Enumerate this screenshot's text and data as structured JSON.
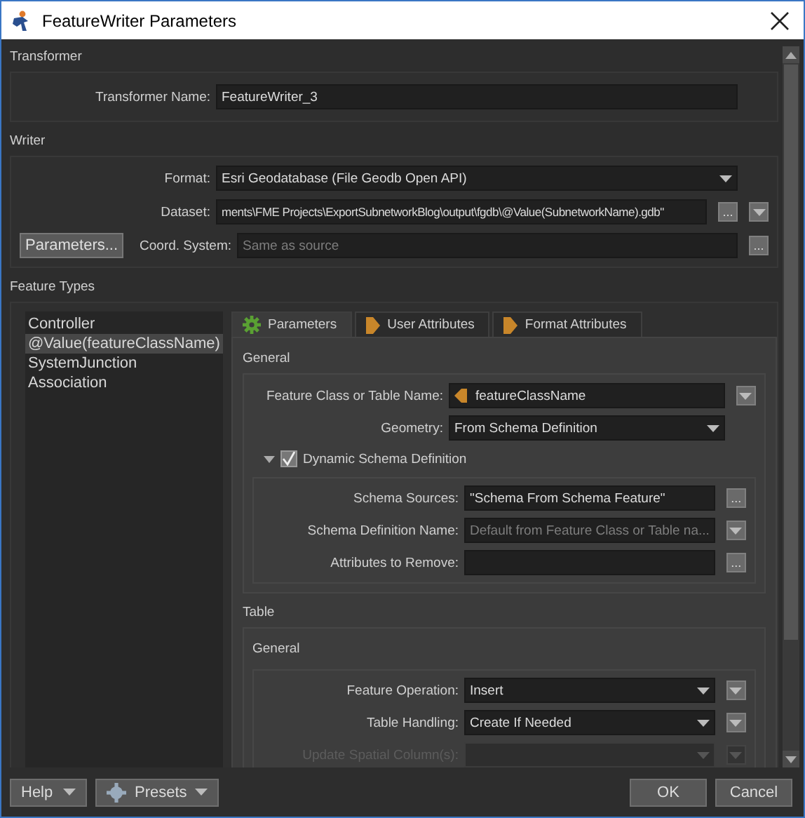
{
  "window": {
    "title": "FeatureWriter Parameters"
  },
  "transformer": {
    "heading": "Transformer",
    "fields": [
      {
        "label": "Transformer Name:",
        "kind": "text",
        "value": "FeatureWriter_3"
      }
    ]
  },
  "writer": {
    "heading": "Writer",
    "fields": [
      {
        "label": "Format:",
        "kind": "combo",
        "value": "Esri Geodatabase (File Geodb Open API)"
      },
      {
        "label": "Dataset:",
        "kind": "text",
        "value": "ments\\FME Projects\\ExportSubnetworkBlog\\output\\fgdb\\@Value(SubnetworkName).gdb\"",
        "buttons": [
          {
            "kind": "ellipsis",
            "text": "..."
          },
          {
            "kind": "menu"
          }
        ]
      },
      {
        "label": "Coord. System:",
        "kind": "text",
        "placeholder": "Same as source",
        "buttons": [
          {
            "kind": "ellipsis",
            "text": "..."
          }
        ]
      }
    ],
    "parameters_button": "Parameters..."
  },
  "feature_types": {
    "heading": "Feature Types",
    "items": [
      {
        "label": "Controller",
        "selected": false
      },
      {
        "label": "@Value(featureClassName)",
        "selected": true
      },
      {
        "label": "SystemJunction",
        "selected": false
      },
      {
        "label": "Association",
        "selected": false
      }
    ]
  },
  "tabs": [
    {
      "label": "Parameters",
      "kind": "gear",
      "selected": true
    },
    {
      "label": "User Attributes",
      "kind": "arrow",
      "selected": false
    },
    {
      "label": "Format Attributes",
      "kind": "arrow",
      "selected": false
    }
  ],
  "general": {
    "heading": "General",
    "fields": [
      {
        "label": "Feature Class or Table Name:",
        "kind": "attribute",
        "value": "featureClassName",
        "buttons": [
          {
            "kind": "menu"
          }
        ]
      },
      {
        "label": "Geometry:",
        "kind": "combo",
        "value": "From Schema Definition"
      }
    ],
    "dynamic_schema": {
      "label": "Dynamic Schema Definition",
      "checked": true,
      "expanded": true,
      "fields": [
        {
          "label": "Schema Sources:",
          "kind": "text",
          "value": "\"Schema From Schema Feature\"",
          "buttons": [
            {
              "kind": "ellipsis",
              "text": "..."
            }
          ]
        },
        {
          "label": "Schema Definition Name:",
          "kind": "text",
          "placeholder": "Default from Feature Class or Table na...",
          "buttons": [
            {
              "kind": "menu"
            }
          ]
        },
        {
          "label": "Attributes to Remove:",
          "kind": "text",
          "buttons": [
            {
              "kind": "ellipsis",
              "text": "..."
            }
          ]
        }
      ]
    }
  },
  "table": {
    "heading": "Table",
    "subheading": "General",
    "fields": [
      {
        "label": "Feature Operation:",
        "kind": "combo",
        "value": "Insert",
        "buttons": [
          {
            "kind": "menu"
          }
        ],
        "disabled": false
      },
      {
        "label": "Table Handling:",
        "kind": "combo",
        "value": "Create If Needed",
        "buttons": [
          {
            "kind": "menu"
          }
        ],
        "disabled": false
      },
      {
        "label": "Update Spatial Column(s):",
        "kind": "combo",
        "buttons": [
          {
            "kind": "menu"
          }
        ],
        "disabled": true
      }
    ]
  },
  "footer": {
    "help": "Help",
    "presets": "Presets",
    "ok": "OK",
    "cancel": "Cancel"
  }
}
